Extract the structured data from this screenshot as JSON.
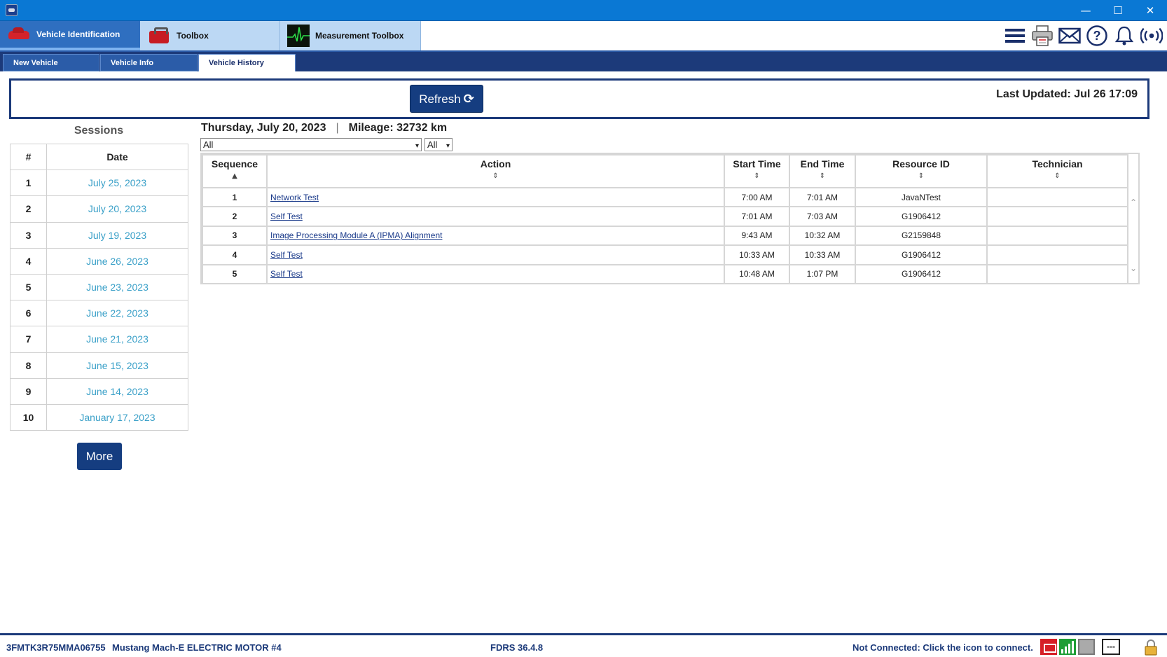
{
  "window": {
    "min_glyph": "—",
    "max_glyph": "☐",
    "close_glyph": "✕"
  },
  "tool_tabs": [
    {
      "label": "Vehicle Identification",
      "icon": "car-icon"
    },
    {
      "label": "Toolbox",
      "icon": "toolbox-icon"
    },
    {
      "label": "Measurement Toolbox",
      "icon": "oscilloscope-icon"
    }
  ],
  "toolbar_icons": [
    "menu-icon",
    "printer-icon",
    "mail-icon",
    "help-icon",
    "bell-icon",
    "connection-icon"
  ],
  "sub_tabs": [
    {
      "label": "New Vehicle",
      "active": false
    },
    {
      "label": "Vehicle Info",
      "active": false
    },
    {
      "label": "Vehicle History",
      "active": true
    }
  ],
  "refresh": {
    "label": "Refresh",
    "icon": "refresh-icon",
    "last_updated": "Last Updated: Jul 26 17:09"
  },
  "sessions": {
    "title": "Sessions",
    "headers": [
      "#",
      "Date"
    ],
    "rows": [
      {
        "num": "1",
        "date": "July 25, 2023"
      },
      {
        "num": "2",
        "date": "July 20, 2023"
      },
      {
        "num": "3",
        "date": "July 19, 2023"
      },
      {
        "num": "4",
        "date": "June 26, 2023"
      },
      {
        "num": "5",
        "date": "June 23, 2023"
      },
      {
        "num": "6",
        "date": "June 22, 2023"
      },
      {
        "num": "7",
        "date": "June 21, 2023"
      },
      {
        "num": "8",
        "date": "June 15, 2023"
      },
      {
        "num": "9",
        "date": "June 14, 2023"
      },
      {
        "num": "10",
        "date": "January 17, 2023"
      }
    ],
    "more_label": "More"
  },
  "day": {
    "date": "Thursday, July 20, 2023",
    "separator": "|",
    "mileage": "Mileage: 32732 km",
    "filter_action": "All",
    "filter_second": "All"
  },
  "actions": {
    "headers": [
      "Sequence",
      "Action",
      "Start Time",
      "End Time",
      "Resource ID",
      "Technician"
    ],
    "rows": [
      {
        "seq": "1",
        "action": "Network Test",
        "start": "7:00 AM",
        "end": "7:01 AM",
        "resource": "JavaNTest",
        "tech": ""
      },
      {
        "seq": "2",
        "action": "Self Test",
        "start": "7:01 AM",
        "end": "7:03 AM",
        "resource": "G1906412",
        "tech": ""
      },
      {
        "seq": "3",
        "action": "Image Processing Module A (IPMA) Alignment",
        "start": "9:43 AM",
        "end": "10:32 AM",
        "resource": "G2159848",
        "tech": ""
      },
      {
        "seq": "4",
        "action": "Self Test",
        "start": "10:33 AM",
        "end": "10:33 AM",
        "resource": "G1906412",
        "tech": ""
      },
      {
        "seq": "5",
        "action": "Self Test",
        "start": "10:48 AM",
        "end": "1:07 PM",
        "resource": "G1906412",
        "tech": ""
      }
    ]
  },
  "status": {
    "vin": "3FMTK3R75MMA06755",
    "model": "Mustang Mach-E ELECTRIC MOTOR #4",
    "version": "FDRS 36.4.8",
    "connection": "Not Connected: Click the icon to connect.",
    "dash_label": "---"
  }
}
